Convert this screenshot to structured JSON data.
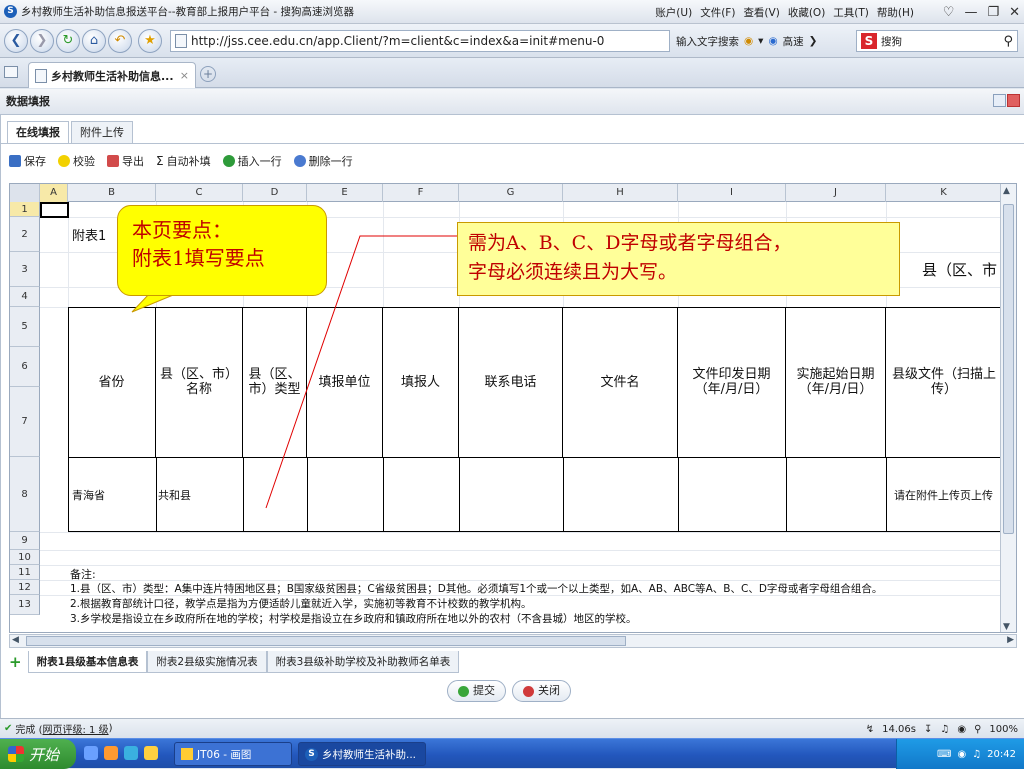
{
  "browser": {
    "window_title": "乡村教师生活补助信息报送平台--教育部上报用户平台 - 搜狗高速浏览器",
    "menus": [
      "账户(U)",
      "文件(F)",
      "查看(V)",
      "收藏(O)",
      "工具(T)",
      "帮助(H)"
    ],
    "url": "http://jss.cee.edu.cn/app.Client/?m=client&c=index&a=init#menu-0",
    "addr_hint": "输入文字搜索",
    "speed_label": "高速",
    "search_engine": "搜狗",
    "tab_title": "乡村教师生活补助信息...",
    "tab_close": "×",
    "new_tab": "+"
  },
  "panel": {
    "title": "数据填报",
    "inner_tabs": [
      "在线填报",
      "附件上传"
    ],
    "toolbar": {
      "save": "保存",
      "check": "校验",
      "export": "导出",
      "autofill": "自动补填",
      "insert_row": "插入一行",
      "delete_row": "删除一行"
    }
  },
  "sheet": {
    "columns": [
      "A",
      "B",
      "C",
      "D",
      "E",
      "F",
      "G",
      "H",
      "I",
      "J",
      "K"
    ],
    "rows": [
      "1",
      "2",
      "3",
      "4",
      "5",
      "6",
      "7",
      "8",
      "9",
      "10",
      "11",
      "12",
      "13"
    ],
    "title_cell": "附表1",
    "region_cell": "县（区、市",
    "headers": [
      "省份",
      "县（区、市）名称",
      "县（区、市）类型",
      "填报单位",
      "填报人",
      "联系电话",
      "文件名",
      "文件印发日期（年/月/日）",
      "实施起始日期（年/月/日）",
      "县级文件（扫描上传）"
    ],
    "data_row": {
      "province": "青海省",
      "county": "共和县",
      "file_hint": "请在附件上传页上传"
    },
    "notes": [
      "备注:",
      "1.县（区、市）类型：A集中连片特困地区县；B国家级贫困县；C省级贫困县；D其他。必须填写1个或一个以上类型，如A、AB、ABC等A、B、C、D字母或者字母组合组合。",
      "2.根据教育部统计口径，教学点是指为方便适龄儿童就近入学，实施初等教育不计校数的教学机构。",
      "3.乡学校是指设立在乡政府所在地的学校；村学校是指设立在乡政府和镇政府所在地以外的农村（不含县城）地区的学校。"
    ]
  },
  "callouts": {
    "left_line1": "本页要点：",
    "left_line2": "附表1填写要点",
    "right_line1": "需为A、B、C、D字母或者字母组合，",
    "right_line2": "字母必须连续且为大写。"
  },
  "sheet_tabs": [
    "附表1县级基本信息表",
    "附表2县级实施情况表",
    "附表3县级补助学校及补助教师名单表"
  ],
  "actions": {
    "submit": "提交",
    "close": "关闭"
  },
  "status": {
    "left": "完成 (",
    "rating_link": "网页评级: 1 级",
    "left_end": ")",
    "timing": "14.06s",
    "zoom": "100%"
  },
  "taskbar": {
    "start": "开始",
    "tasks": [
      "JT06 - 画图",
      "乡村教师生活补助..."
    ],
    "clock": "20:42"
  },
  "colors": {
    "callout_fill": "#ffff00",
    "callout_text": "#c00000",
    "callout2_fill": "#ffff99"
  }
}
